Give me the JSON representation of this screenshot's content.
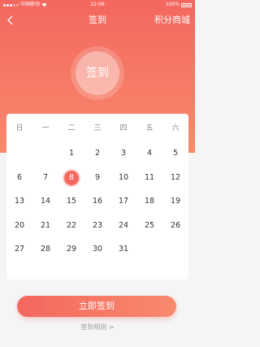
{
  "status": {
    "carrier": "中国移动",
    "time": "22:06",
    "battery": "100%"
  },
  "nav": {
    "title": "签到",
    "right_link": "积分商城"
  },
  "sign_circle": {
    "label": "签到"
  },
  "calendar": {
    "weekdays": [
      "日",
      "一",
      "二",
      "三",
      "四",
      "五",
      "六"
    ],
    "rows": [
      [
        "",
        "",
        "1",
        "2",
        "3",
        "4",
        "5"
      ],
      [
        "6",
        "7",
        "8",
        "9",
        "10",
        "11",
        "12"
      ],
      [
        "13",
        "14",
        "15",
        "16",
        "17",
        "18",
        "19"
      ],
      [
        "20",
        "21",
        "22",
        "23",
        "24",
        "25",
        "26"
      ],
      [
        "27",
        "28",
        "29",
        "30",
        "31",
        "",
        ""
      ]
    ],
    "today": "8"
  },
  "cta": {
    "label": "立即签到"
  },
  "rules_link": "签到规则 >",
  "colors": {
    "accent": "#f3675f",
    "accent_light": "#f88a6d"
  }
}
